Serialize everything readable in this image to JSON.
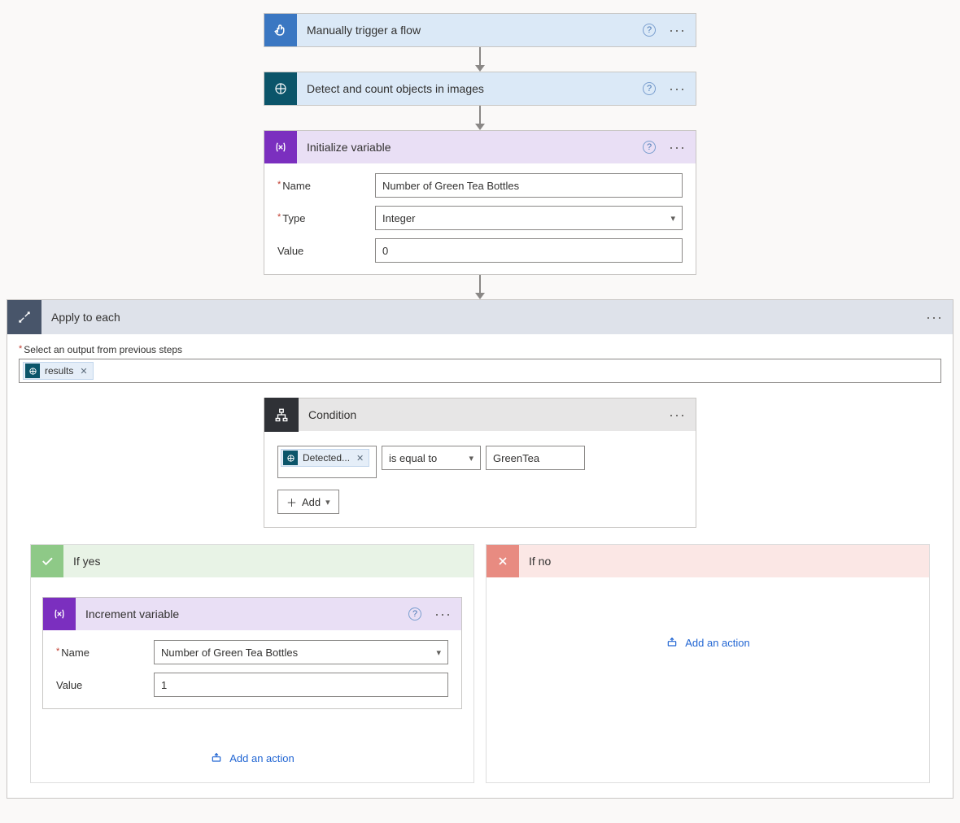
{
  "steps": {
    "trigger": {
      "title": "Manually trigger a flow"
    },
    "detect": {
      "title": "Detect and count objects in images"
    },
    "initVar": {
      "title": "Initialize variable",
      "nameLabel": "Name",
      "nameValue": "Number of Green Tea Bottles",
      "typeLabel": "Type",
      "typeValue": "Integer",
      "valueLabel": "Value",
      "valueValue": "0"
    }
  },
  "applyEach": {
    "title": "Apply to each",
    "selectLabel": "Select an output from previous steps",
    "token": "results"
  },
  "condition": {
    "title": "Condition",
    "lhsToken": "Detected...",
    "operator": "is equal to",
    "rhs": "GreenTea",
    "addLabel": "Add"
  },
  "branches": {
    "yes": {
      "title": "If yes",
      "card": {
        "title": "Increment variable",
        "nameLabel": "Name",
        "nameValue": "Number of Green Tea Bottles",
        "valueLabel": "Value",
        "valueValue": "1"
      },
      "addAction": "Add an action"
    },
    "no": {
      "title": "If no",
      "addAction": "Add an action"
    }
  }
}
